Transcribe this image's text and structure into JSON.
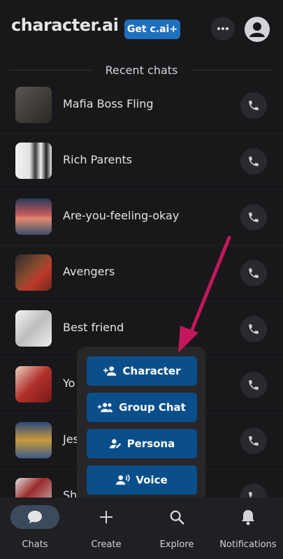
{
  "header": {
    "logo": "character.ai",
    "upgrade_label": "Get c.ai+",
    "more_icon": "more-horizontal-icon",
    "profile_icon": "user-avatar-icon"
  },
  "section": {
    "title": "Recent chats"
  },
  "chats": [
    {
      "name": "Mafia Boss Fling",
      "thumb_color": "#3d3a36"
    },
    {
      "name": "Rich Parents",
      "thumb_color": "#d9d9d9"
    },
    {
      "name": "Are-you-feeling-okay",
      "thumb_color": "#b8555a"
    },
    {
      "name": "Avengers",
      "thumb_color": "#7a3b2a"
    },
    {
      "name": "Best friend",
      "thumb_color": "#cfcfcf"
    },
    {
      "name": "Yo",
      "thumb_color": "#a8322c"
    },
    {
      "name": "Jes",
      "thumb_color": "#2e4a7a"
    },
    {
      "name": "Sh",
      "thumb_color": "#8a8a8a"
    }
  ],
  "popup": {
    "items": [
      {
        "label": "Character",
        "icon": "person-add-icon"
      },
      {
        "label": "Group Chat",
        "icon": "group-add-icon"
      },
      {
        "label": "Persona",
        "icon": "persona-edit-icon"
      },
      {
        "label": "Voice",
        "icon": "voice-icon"
      }
    ]
  },
  "nav": {
    "items": [
      {
        "label": "Chats",
        "icon": "chat-bubble-icon",
        "active": true
      },
      {
        "label": "Create",
        "icon": "plus-icon"
      },
      {
        "label": "Explore",
        "icon": "search-icon"
      },
      {
        "label": "Notifications",
        "icon": "bell-icon"
      }
    ]
  },
  "colors": {
    "background": "#18181b",
    "accent_button": "#0b4f8a",
    "annotation_arrow": "#c2185b"
  }
}
